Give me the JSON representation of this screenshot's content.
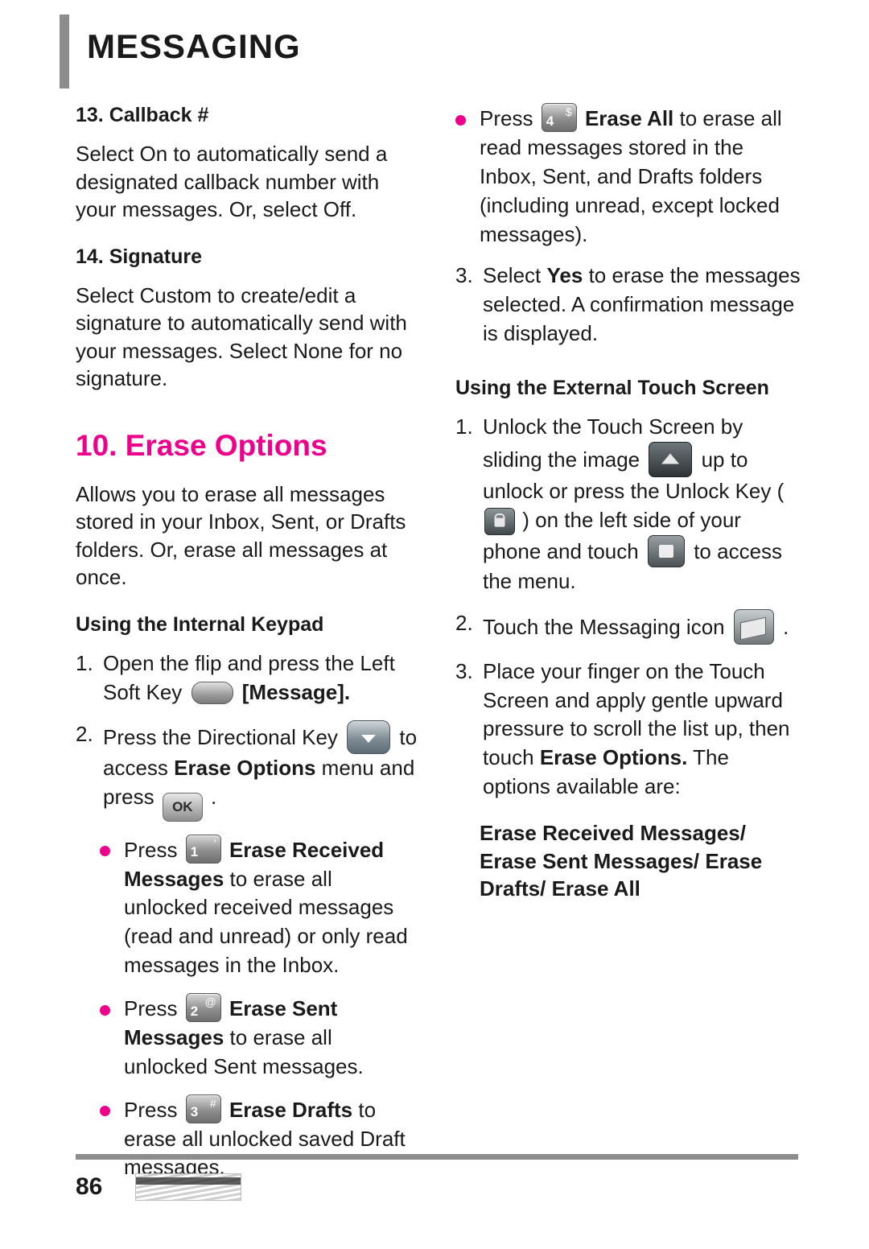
{
  "header": {
    "title": "MESSAGING"
  },
  "colors": {
    "accent": "#ec008c",
    "rule": "#8d8d8d",
    "text": "#1a1a1a"
  },
  "left": {
    "h_callback": "13. Callback #",
    "p_callback": "Select On to automatically send a designated callback number with your messages. Or, select Off.",
    "h_signature": "14. Signature",
    "p_signature": "Select Custom to create/edit a signature to automatically send with your messages. Select None for no signature.",
    "h_section": "10. Erase Options",
    "p_section": "Allows you to erase all messages stored in your Inbox, Sent, or Drafts folders. Or, erase all messages at once.",
    "h_keypad": "Using the Internal Keypad",
    "step1_num": "1.",
    "step1_a": "Open the flip and press the Left Soft Key",
    "step1_b": "[Message].",
    "step2_num": "2.",
    "step2_a": "Press the Directional Key",
    "step2_b": "to access",
    "step2_c": "Erase Options",
    "step2_d": "menu and press",
    "step2_e": ".",
    "b1_press": "Press",
    "b1_key": {
      "num": "1",
      "sym": "'"
    },
    "b1_bold": "Erase Received Messages",
    "b1_rest": "to erase all unlocked received messages (read and unread) or only read messages in the Inbox.",
    "b2_press": "Press",
    "b2_key": {
      "num": "2",
      "sym": "@"
    },
    "b2_bold": "Erase Sent Messages",
    "b2_rest": "to erase all unlocked Sent messages.",
    "b3_press": "Press",
    "b3_key": {
      "num": "3",
      "sym": "#"
    },
    "b3_bold": "Erase Drafts",
    "b3_rest": "to erase all unlocked saved Draft messages."
  },
  "right": {
    "b4_press": "Press",
    "b4_key": {
      "num": "4",
      "sym": "$"
    },
    "b4_bold": "Erase All",
    "b4_rest": "to erase all read messages stored in the Inbox, Sent, and Drafts folders (including unread, except locked messages).",
    "step3_num": "3.",
    "step3_a": "Select",
    "step3_bold": "Yes",
    "step3_b": "to erase the messages selected. A confirmation message is displayed.",
    "h_touch": "Using the External Touch Screen",
    "t1_num": "1.",
    "t1_a": "Unlock the Touch Screen by sliding the image",
    "t1_b": "up to unlock or press the Unlock Key",
    "t1_c": ") on the left side of your phone and touch",
    "t1_d": "to access the menu.",
    "t1_paren": "(",
    "t2_num": "2.",
    "t2_a": "Touch the Messaging icon",
    "t2_b": ".",
    "t3_num": "3.",
    "t3_a": "Place your finger on the Touch Screen and apply gentle upward pressure to scroll the list up, then touch",
    "t3_bold": "Erase Options.",
    "t3_b": "The options available are:",
    "options_bold": "Erase Received Messages/ Erase Sent Messages/ Erase Drafts/ Erase All"
  },
  "footer": {
    "page_number": "86"
  }
}
